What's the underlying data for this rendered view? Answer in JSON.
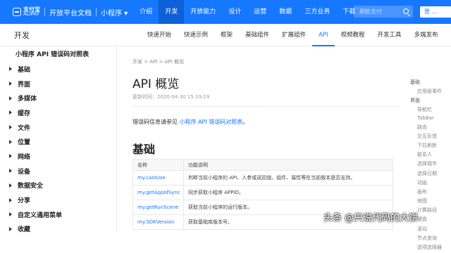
{
  "header": {
    "logo_line1": "支付宝",
    "logo_line2": "ALIPAY",
    "site_title": "开放平台文档",
    "product": "小程序",
    "product_caret": "▾",
    "nav": [
      "介绍",
      "开发",
      "开放能力",
      "设计",
      "运营",
      "数据",
      "三方业务",
      "下载"
    ],
    "search_placeholder": "刷脸支付",
    "login_label": "登 ..."
  },
  "subheader": {
    "title": "开发",
    "tabs": [
      "快速开始",
      "快速示例",
      "框架",
      "基础组件",
      "扩展组件",
      "API",
      "视频教程",
      "开发工具",
      "多端发布"
    ]
  },
  "sidebar": {
    "heading": "小程序 API 错误码对照表",
    "items": [
      "基础",
      "界面",
      "多媒体",
      "缓存",
      "文件",
      "位置",
      "网络",
      "设备",
      "数据安全",
      "分享",
      "自定义通用菜单",
      "收藏"
    ]
  },
  "main": {
    "breadcrumb": "开发 > API > API 概览",
    "title": "API 概览",
    "updated": "更新时间：2020-04-30 15:19:19",
    "intro_prefix": "错误码信息请参见 ",
    "intro_link": "小程序 API 错误码对照表",
    "intro_suffix": "。",
    "section_title": "基础",
    "table_headers": [
      "名称",
      "功能说明"
    ],
    "rows": [
      {
        "name": "my.canIUse",
        "desc": "判断当前小程序的 API、入参或返回值、组件、属性等在当前版本是否支持。"
      },
      {
        "name": "my.getAppIdSync",
        "desc": "同步获取小程序 APPID。"
      },
      {
        "name": "my.getRunScene",
        "desc": "获取当前小程序的运行版本。"
      },
      {
        "name": "my.SDKVersion",
        "desc": "获取基础库版本号。"
      }
    ]
  },
  "toc": {
    "items": [
      {
        "level": 1,
        "label": "基础"
      },
      {
        "level": 2,
        "label": "应用级事件"
      },
      {
        "level": 1,
        "label": "界面"
      },
      {
        "level": 2,
        "label": "导航栏"
      },
      {
        "level": 2,
        "label": "TabBar"
      },
      {
        "level": 2,
        "label": "路由"
      },
      {
        "level": 2,
        "label": "交互反馈"
      },
      {
        "level": 2,
        "label": "下拉刷新"
      },
      {
        "level": 2,
        "label": "联系人"
      },
      {
        "level": 2,
        "label": "选择城市"
      },
      {
        "level": 2,
        "label": "选择日期"
      },
      {
        "level": 2,
        "label": "动画"
      },
      {
        "level": 2,
        "label": "画布"
      },
      {
        "level": 2,
        "label": "地图"
      },
      {
        "level": 2,
        "label": "计算路径"
      },
      {
        "level": 2,
        "label": "键盘"
      },
      {
        "level": 2,
        "label": "滚动"
      },
      {
        "level": 2,
        "label": "节点查询"
      },
      {
        "level": 2,
        "label": "选项选择器"
      }
    ]
  },
  "watermark": "头条 @只说代码的大饼",
  "colors": {
    "brand": "#1677ff",
    "nav_active": "#0e5fd8"
  }
}
